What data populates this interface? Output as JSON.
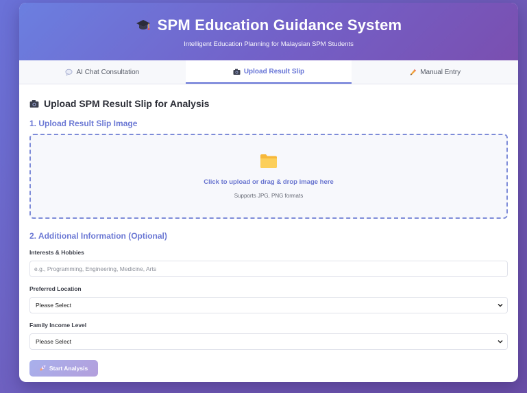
{
  "header": {
    "title": "SPM Education Guidance System",
    "subtitle": "Intelligent Education Planning for Malaysian SPM Students",
    "icon": "graduation-cap-icon"
  },
  "tabs": [
    {
      "label": "AI Chat Consultation",
      "icon": "speech-bubble-icon",
      "active": false
    },
    {
      "label": "Upload Result Slip",
      "icon": "camera-icon",
      "active": true
    },
    {
      "label": "Manual Entry",
      "icon": "pencil-icon",
      "active": false
    }
  ],
  "main": {
    "section_title": "Upload SPM Result Slip for Analysis",
    "step1_title": "1. Upload Result Slip Image",
    "dropzone": {
      "icon": "folder-icon",
      "text": "Click to upload or drag & drop image here",
      "hint": "Supports JPG, PNG formats"
    },
    "step2_title": "2. Additional Information (Optional)",
    "interests": {
      "label": "Interests & Hobbies",
      "placeholder": "e.g., Programming, Engineering, Medicine, Arts",
      "value": ""
    },
    "location": {
      "label": "Preferred Location",
      "selected": "Please Select"
    },
    "income": {
      "label": "Family Income Level",
      "selected": "Please Select"
    },
    "start_button": {
      "label": "Start Analysis",
      "icon": "rocket-icon"
    }
  },
  "colors": {
    "accent": "#6674d6",
    "header_start": "#6b7fe0",
    "header_end": "#7a4fb0",
    "button_start": "#a8b0ec",
    "button_end": "#b39fdc"
  }
}
